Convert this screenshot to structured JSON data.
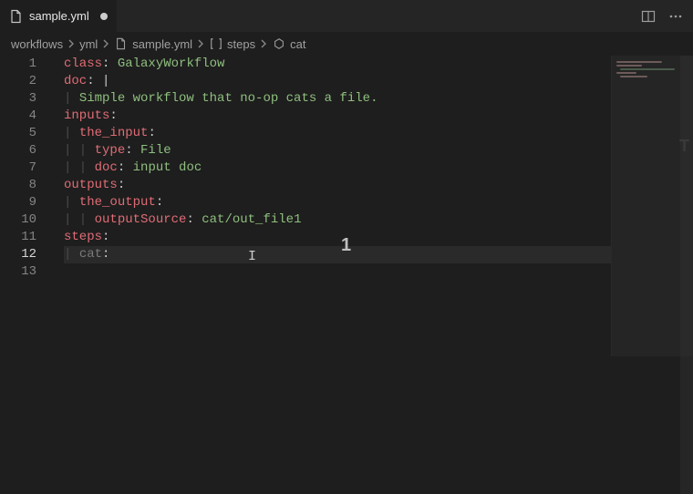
{
  "tab": {
    "filename": "sample.yml",
    "dirty": true
  },
  "breadcrumb": {
    "parts": [
      "workflows",
      "yml",
      "sample.yml",
      "steps",
      "cat"
    ]
  },
  "code": {
    "lines": [
      {
        "n": 1,
        "segments": [
          [
            "key",
            "class"
          ],
          [
            "punc",
            ": "
          ],
          [
            "val",
            "GalaxyWorkflow"
          ]
        ]
      },
      {
        "n": 2,
        "segments": [
          [
            "key",
            "doc"
          ],
          [
            "punc",
            ": "
          ],
          [
            "punc",
            "|"
          ]
        ]
      },
      {
        "n": 3,
        "segments": [
          [
            "pipe",
            "| "
          ],
          [
            "str",
            "Simple workflow that no-op cats a file."
          ]
        ]
      },
      {
        "n": 4,
        "segments": [
          [
            "key",
            "inputs"
          ],
          [
            "punc",
            ":"
          ]
        ]
      },
      {
        "n": 5,
        "segments": [
          [
            "pipe",
            "| "
          ],
          [
            "key",
            "the_input"
          ],
          [
            "punc",
            ":"
          ]
        ]
      },
      {
        "n": 6,
        "segments": [
          [
            "pipe",
            "| | "
          ],
          [
            "key",
            "type"
          ],
          [
            "punc",
            ": "
          ],
          [
            "val",
            "File"
          ]
        ]
      },
      {
        "n": 7,
        "segments": [
          [
            "pipe",
            "| | "
          ],
          [
            "key",
            "doc"
          ],
          [
            "punc",
            ": "
          ],
          [
            "val",
            "input doc"
          ]
        ]
      },
      {
        "n": 8,
        "segments": [
          [
            "key",
            "outputs"
          ],
          [
            "punc",
            ":"
          ]
        ]
      },
      {
        "n": 9,
        "segments": [
          [
            "pipe",
            "| "
          ],
          [
            "key",
            "the_output"
          ],
          [
            "punc",
            ":"
          ]
        ]
      },
      {
        "n": 10,
        "segments": [
          [
            "pipe",
            "| | "
          ],
          [
            "key",
            "outputSource"
          ],
          [
            "punc",
            ": "
          ],
          [
            "val",
            "cat/out_file1"
          ]
        ]
      },
      {
        "n": 11,
        "segments": [
          [
            "key",
            "steps"
          ],
          [
            "punc",
            ":"
          ]
        ]
      },
      {
        "n": 12,
        "segments": [
          [
            "pipe",
            "| "
          ],
          [
            "dim",
            "cat"
          ],
          [
            "punc",
            ":"
          ]
        ],
        "current": true
      },
      {
        "n": 13,
        "segments": []
      }
    ]
  },
  "suggest_badge": "1",
  "aa_indicator": "T"
}
